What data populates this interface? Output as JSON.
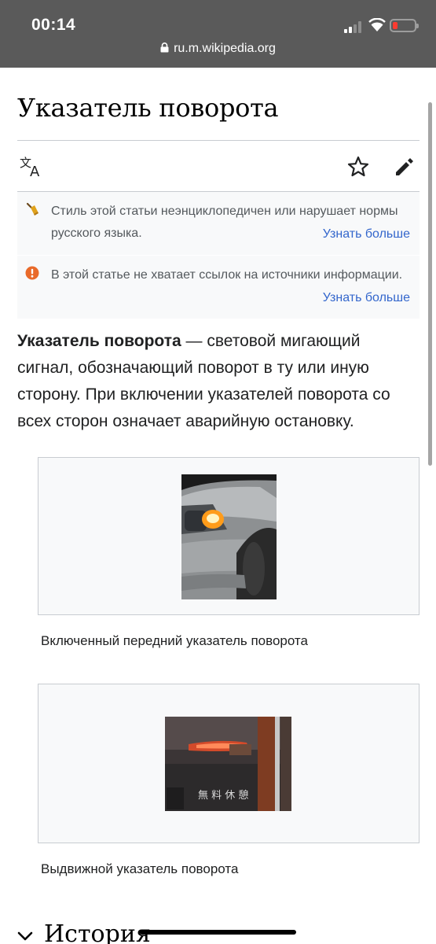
{
  "status_bar": {
    "time": "00:14",
    "url": "ru.m.wikipedia.org"
  },
  "article": {
    "title": "Указатель поворота",
    "notices": [
      {
        "icon": "broom-icon",
        "text": "Стиль этой статьи неэнциклопедичен или нарушает нормы русского языка.",
        "link": "Узнать больше"
      },
      {
        "icon": "warning-icon",
        "text": "В этой статье не хватает ссылок на источники информации.",
        "link": "Узнать больше"
      }
    ],
    "lead_bold": "Указатель поворота",
    "lead_rest": " — световой мигающий сигнал, обозначающий поворот в ту или иную сторону. При включении указателей поворота со всех сторон означает аварийную остановку.",
    "figures": [
      {
        "caption": "Включенный передний указатель поворота"
      },
      {
        "caption": "Выдвижной указатель поворота"
      }
    ],
    "section_heading": "История"
  },
  "colors": {
    "link": "#3366cc",
    "notice_bg": "#f8f9fa",
    "warning": "#dd3333",
    "topbar": "#5a5a5a"
  }
}
